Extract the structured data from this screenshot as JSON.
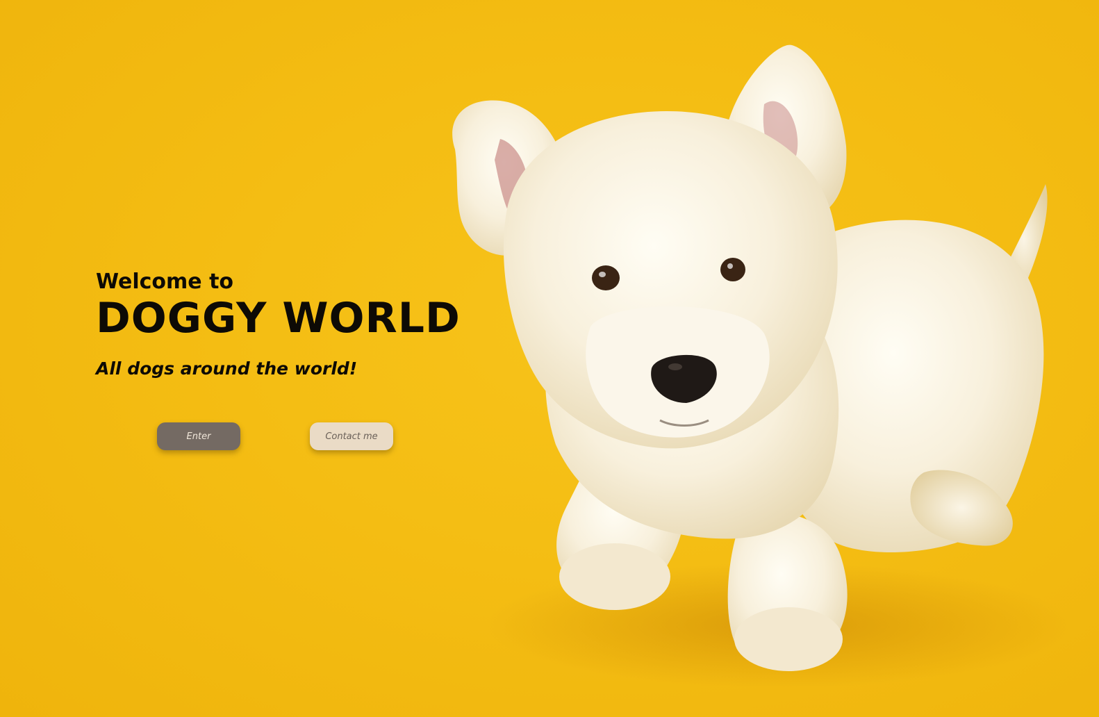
{
  "hero": {
    "welcome": "Welcome to",
    "brand": "DOGGY WORLD",
    "tagline": "All dogs around the world!"
  },
  "buttons": {
    "enter": "Enter",
    "contact": "Contact me"
  },
  "colors": {
    "background": "#f4bd13",
    "heading": "#0d0a05",
    "enter_button": "#746a63",
    "contact_button": "#eadbc6"
  },
  "image": {
    "subject": "white-terrier-dog-photo"
  }
}
